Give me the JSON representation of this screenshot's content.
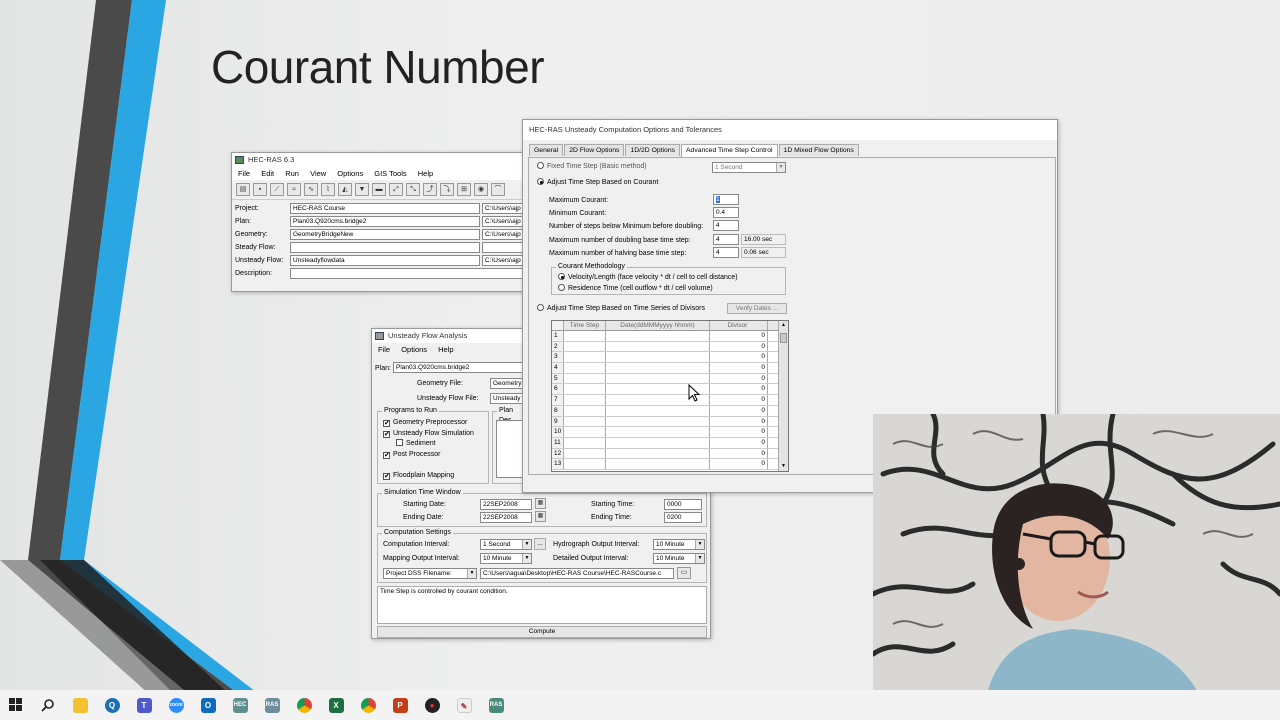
{
  "slide": {
    "title": "Courant Number"
  },
  "hecras_main": {
    "title": "HEC-RAS 6.3",
    "menu": [
      "File",
      "Edit",
      "Run",
      "View",
      "Options",
      "GIS Tools",
      "Help"
    ],
    "rows": [
      {
        "label": "Project:",
        "value": "HEC-RAS Course",
        "path": "C:\\Users\\ajp"
      },
      {
        "label": "Plan:",
        "value": "Plan03.Q920cms.bridge2",
        "path": "C:\\Users\\ajp"
      },
      {
        "label": "Geometry:",
        "value": "GeometryBridgeNew",
        "path": "C:\\Users\\ajp"
      },
      {
        "label": "Steady Flow:",
        "value": "",
        "path": ""
      },
      {
        "label": "Unsteady Flow:",
        "value": "Unsteadyflowdata",
        "path": "C:\\Users\\ajp"
      },
      {
        "label": "Description:",
        "value": "",
        "path": ""
      }
    ]
  },
  "unsteady": {
    "title": "Unsteady Flow Analysis",
    "menu": [
      "File",
      "Options",
      "Help"
    ],
    "plan_label": "Plan:",
    "plan_value": "Plan03.Q920cms.bridge2",
    "geometry_label": "Geometry File:",
    "geometry_value": "Geometry",
    "flow_label": "Unsteady Flow File:",
    "flow_value": "Unsteady",
    "programs_title": "Programs to Run",
    "programs": [
      {
        "label": "Geometry Preprocessor",
        "checked": "✔"
      },
      {
        "label": "Unsteady Flow Simulation",
        "checked": "✔"
      },
      {
        "label": "Sediment",
        "checked": ""
      },
      {
        "label": "Post Processor",
        "checked": "✔"
      },
      {
        "label": "Floodplain Mapping",
        "checked": "✔"
      }
    ],
    "plan_desc_title": "Plan Des",
    "sim_title": "Simulation Time Window",
    "starting_date_label": "Starting Date:",
    "starting_date": "22SEP2008",
    "ending_date_label": "Ending Date:",
    "ending_date": "22SEP2008",
    "starting_time_label": "Starting Time:",
    "starting_time": "0000",
    "ending_time_label": "Ending Time:",
    "ending_time": "0200",
    "comp_title": "Computation Settings",
    "comp_interval_label": "Computation Interval:",
    "comp_interval": "1 Second",
    "hydro_label": "Hydrograph Output Interval:",
    "hydro_value": "10 Minute",
    "mapping_label": "Mapping Output Interval:",
    "mapping_value": "10 Minute",
    "detailed_label": "Detailed Output Interval:",
    "detailed_value": "10 Minute",
    "dss_label": "Project DSS Filename:",
    "dss_value": "C:\\Users\\agua\\Desktop\\HEC-RAS Course\\HEC-RASCourse.c",
    "status": "Time Step is controlled by courant condition.",
    "compute": "Compute"
  },
  "options": {
    "title": "HEC-RAS Unsteady Computation Options and Tolerances",
    "tabs": [
      "General",
      "2D Flow Options",
      "1D/2D Options",
      "Advanced Time Step Control",
      "1D Mixed Flow Options"
    ],
    "fixed_label": "Fixed Time Step (Basic method)",
    "fixed_value": "1 Second",
    "adjust_courant_label": "Adjust Time Step Based on Courant",
    "max_courant_label": "Maximum Courant:",
    "max_courant": "1",
    "min_courant_label": "Minimum Courant:",
    "min_courant": "0.4",
    "steps_label": "Number of steps below Minimum before doubling:",
    "steps": "4",
    "doubling_label": "Maximum number of doubling base time step:",
    "doubling": "4",
    "doubling_sec": "16.00 sec",
    "halving_label": "Maximum number of halving base time step:",
    "halving": "4",
    "halving_sec": "0.06 sec",
    "method_title": "Courant Methodology",
    "method1": "Velocity/Length (face velocity * dt / cell to cell distance)",
    "method2": "Residence Time (cell outflow * dt / cell volume)",
    "divisors_label": "Adjust Time Step Based on Time Series of Divisors",
    "verify": "Verify Dates ...",
    "grid_headers": [
      "Time Step",
      "Date(ddMMMyyyy hhmm)",
      "Divisor"
    ],
    "grid_rows": [
      {
        "n": "1",
        "v": "0"
      },
      {
        "n": "2",
        "v": "0"
      },
      {
        "n": "3",
        "v": "0"
      },
      {
        "n": "4",
        "v": "0"
      },
      {
        "n": "5",
        "v": "0"
      },
      {
        "n": "6",
        "v": "0"
      },
      {
        "n": "7",
        "v": "0"
      },
      {
        "n": "8",
        "v": "0"
      },
      {
        "n": "9",
        "v": "0"
      },
      {
        "n": "10",
        "v": "0"
      },
      {
        "n": "11",
        "v": "0"
      },
      {
        "n": "12",
        "v": "0"
      },
      {
        "n": "13",
        "v": "0"
      }
    ]
  },
  "taskbar": {
    "icons": [
      "windows-start-icon",
      "search-icon",
      "file-explorer-icon",
      "quicktime-icon",
      "teams-icon",
      "zoom-icon",
      "outlook-icon",
      "hec-ras-icon",
      "hec-ras-icon-2",
      "chrome-icon",
      "excel-icon",
      "chrome-icon-2",
      "powerpoint-icon",
      "app-icon",
      "paint-icon",
      "hec-ras-icon-3"
    ]
  },
  "colors": {
    "stripe_blue": "#29a3e0",
    "stripe_dark": "#3d3d3d",
    "stripe_gray": "#8a8a8a"
  }
}
